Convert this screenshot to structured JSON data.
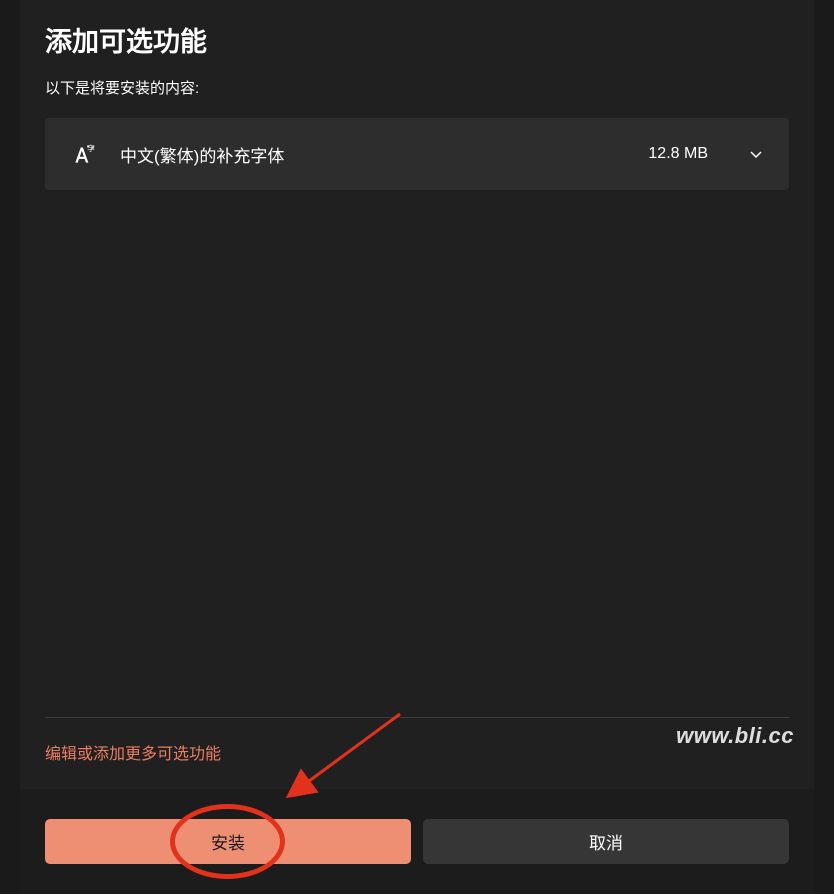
{
  "dialog": {
    "title": "添加可选功能",
    "subtitle": "以下是将要安装的内容:",
    "edit_link": "编辑或添加更多可选功能"
  },
  "features": [
    {
      "name": "中文(繁体)的补充字体",
      "size": "12.8 MB"
    }
  ],
  "buttons": {
    "install": "安装",
    "cancel": "取消"
  },
  "watermark": "www.bli.cc"
}
